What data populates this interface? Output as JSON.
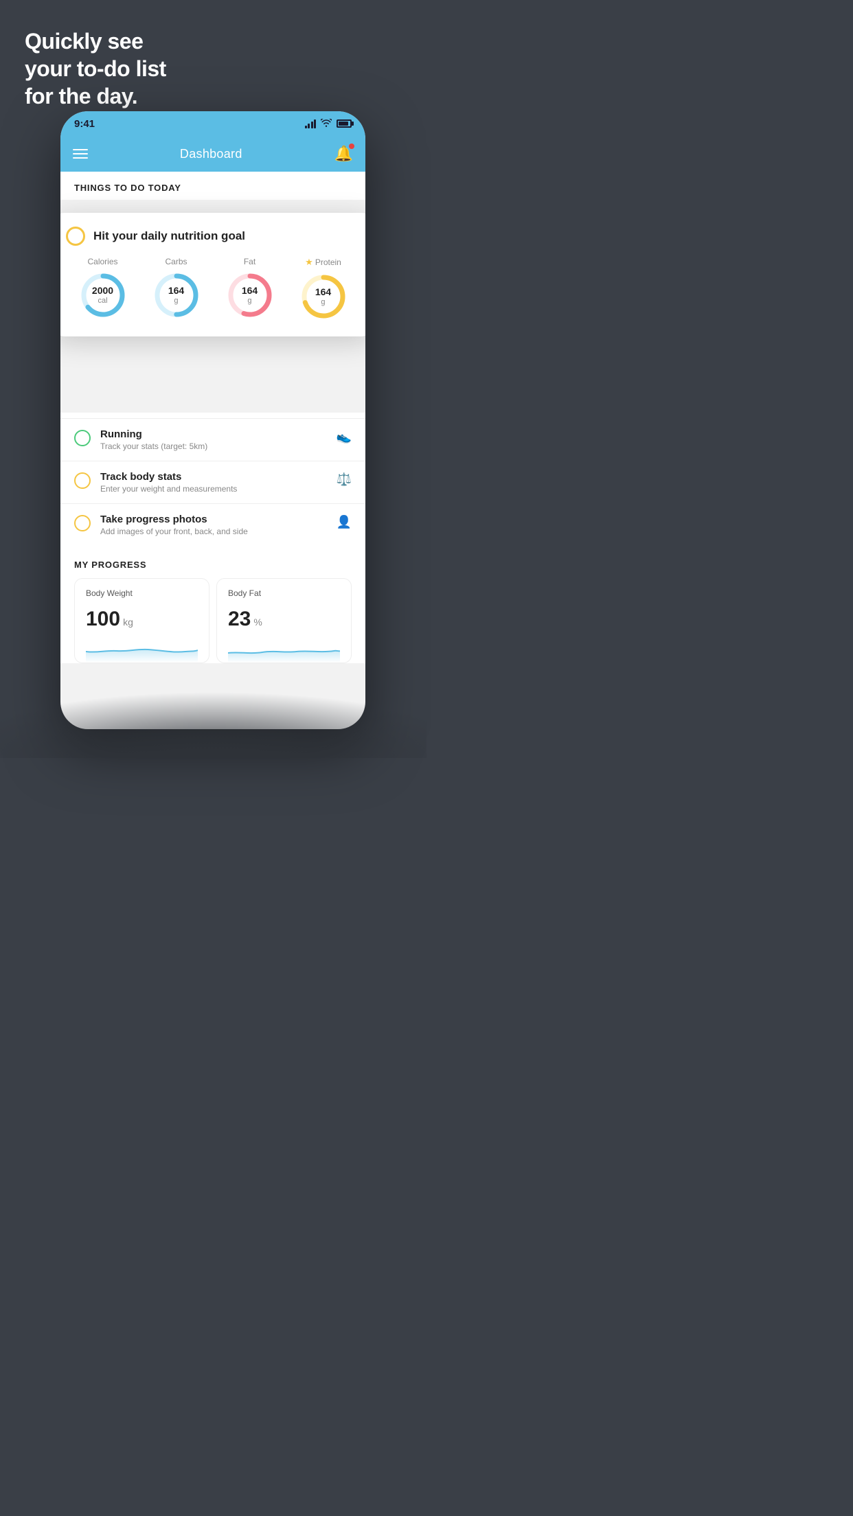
{
  "hero": {
    "line1": "Quickly see",
    "line2": "your to-do list",
    "line3": "for the day."
  },
  "status_bar": {
    "time": "9:41"
  },
  "nav": {
    "title": "Dashboard"
  },
  "things_section": {
    "header": "THINGS TO DO TODAY"
  },
  "nutrition_card": {
    "title": "Hit your daily nutrition goal",
    "items": [
      {
        "label": "Calories",
        "value": "2000",
        "unit": "cal",
        "color": "#5bbde4",
        "bg": "#d6f0fb",
        "percent": 65,
        "has_star": false
      },
      {
        "label": "Carbs",
        "value": "164",
        "unit": "g",
        "color": "#5bbde4",
        "bg": "#d6f0fb",
        "percent": 50,
        "has_star": false
      },
      {
        "label": "Fat",
        "value": "164",
        "unit": "g",
        "color": "#f47b8c",
        "bg": "#fddde2",
        "percent": 55,
        "has_star": false
      },
      {
        "label": "Protein",
        "value": "164",
        "unit": "g",
        "color": "#f5c542",
        "bg": "#fef3cc",
        "percent": 70,
        "has_star": true
      }
    ]
  },
  "todo_items": [
    {
      "id": "running",
      "title": "Running",
      "subtitle": "Track your stats (target: 5km)",
      "circle_color": "green",
      "icon": "👟"
    },
    {
      "id": "body-stats",
      "title": "Track body stats",
      "subtitle": "Enter your weight and measurements",
      "circle_color": "yellow",
      "icon": "⚖️"
    },
    {
      "id": "photos",
      "title": "Take progress photos",
      "subtitle": "Add images of your front, back, and side",
      "circle_color": "yellow",
      "icon": "👤"
    }
  ],
  "progress": {
    "header": "MY PROGRESS",
    "cards": [
      {
        "id": "body-weight",
        "title": "Body Weight",
        "value": "100",
        "unit": "kg"
      },
      {
        "id": "body-fat",
        "title": "Body Fat",
        "value": "23",
        "unit": "%"
      }
    ]
  }
}
